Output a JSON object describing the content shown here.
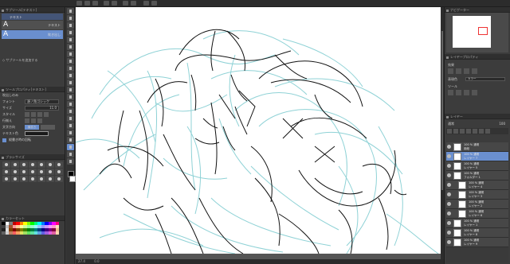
{
  "subtool_panel": {
    "title": "サブツール[テキスト]",
    "tab_label": "テキスト",
    "items": [
      {
        "glyph": "A",
        "label": "テキスト"
      },
      {
        "glyph": "A",
        "label": "吹き出し"
      }
    ],
    "add_label": "サブツールを追加する"
  },
  "tool_property": {
    "title": "ツールプロパティ[テキスト]",
    "subtitle": "吹出しのみ",
    "rows": [
      {
        "label": "フォント",
        "value": "源ノ角ゴシック"
      },
      {
        "label": "サイズ",
        "value": "11.0"
      },
      {
        "label": "スタイル",
        "value": ""
      },
      {
        "label": "行揃え",
        "value": ""
      },
      {
        "label": "文字方向",
        "value": "横書き"
      },
      {
        "label": "テキスト色",
        "value": ""
      },
      {
        "label": "",
        "value": "縦書き時の回転"
      }
    ]
  },
  "brush_panel": {
    "title": "ブラシサイズ"
  },
  "color_panel": {
    "title": "カラーセット"
  },
  "navigator": {
    "title": "ナビゲーター"
  },
  "layer_property": {
    "title": "レイヤープロパティ",
    "rows": [
      {
        "label": "効果"
      },
      {
        "label": "表現色",
        "value": "カラー"
      },
      {
        "label": "ツール"
      }
    ]
  },
  "layer_panel": {
    "title": "レイヤー",
    "blend": "通常",
    "opacity": "100",
    "layers": [
      {
        "mode": "100 % 通常",
        "name": "用紙"
      },
      {
        "mode": "100 % 通常",
        "name": "レイヤー 7",
        "selected": true
      },
      {
        "mode": "100 % 通常",
        "name": "レイヤー 5"
      },
      {
        "mode": "100 % 通常",
        "name": "フォルダー 1"
      },
      {
        "mode": "100 % 通常",
        "name": "レイヤー 4"
      },
      {
        "mode": "100 % 通常",
        "name": "レイヤー 3"
      },
      {
        "mode": "100 % 通常",
        "name": "レイヤー 2"
      },
      {
        "mode": "100 % 通常",
        "name": "レイヤー 6"
      },
      {
        "mode": "100 % 通常",
        "name": "レイヤー 1"
      },
      {
        "mode": "100 % 通常",
        "name": "レイヤー 8"
      },
      {
        "mode": "100 % 通常",
        "name": "レイヤー 9"
      }
    ]
  },
  "status_bar": {
    "zoom": "27.4",
    "angle": "0.0"
  },
  "colors": {
    "accent": "#6a8fcf",
    "sketch_cyan": "#8fd2d6",
    "line_black": "#111111",
    "swatches": [
      "#000000",
      "#ffffff",
      "#7f7f7f",
      "#c00000",
      "#ff0000",
      "#ff8000",
      "#ffff00",
      "#80ff00",
      "#00ff00",
      "#00ff80",
      "#00ffff",
      "#0080ff",
      "#0000ff",
      "#8000ff",
      "#ff00ff",
      "#ff0080",
      "#3f3f3f",
      "#bfbfbf",
      "#a0522d",
      "#ff9999",
      "#ffcc99",
      "#ffff99",
      "#ccff99",
      "#99ff99",
      "#99ffcc",
      "#99ffff",
      "#99ccff",
      "#9999ff",
      "#cc99ff",
      "#ff99ff",
      "#ff99cc",
      "#ffe0c0",
      "#202020",
      "#e0e0e0",
      "#804000",
      "#800000",
      "#804000",
      "#808000",
      "#408000",
      "#008000",
      "#008040",
      "#008080",
      "#004080",
      "#000080",
      "#400080",
      "#800080",
      "#800040",
      "#f0c090",
      "#606060",
      "#d0d0d0",
      "#c08060",
      "#ff6060",
      "#ffa060",
      "#e0e060",
      "#a0e060",
      "#60e060",
      "#60e0a0",
      "#60e0e0",
      "#60a0e0",
      "#6060e0",
      "#a060e0",
      "#e060e0",
      "#e060a0",
      "#ffd8b0"
    ]
  }
}
